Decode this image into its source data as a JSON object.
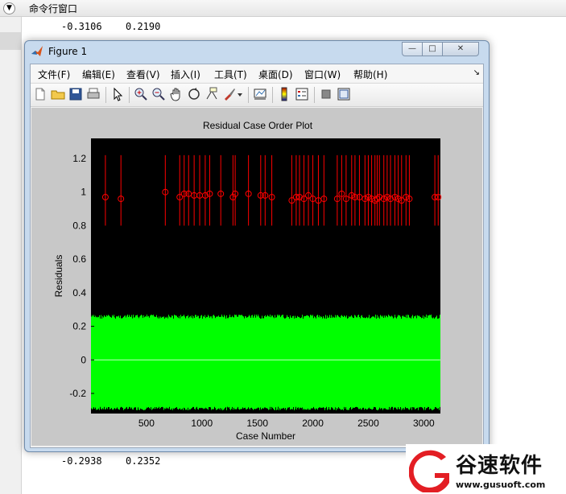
{
  "command_window": {
    "title": "命令行窗口",
    "toggle_glyph": "▼",
    "lines": [
      {
        "a": "-0.3106",
        "b": "0.2190"
      },
      {
        "a": "-0.2938",
        "b": "0.2352"
      }
    ]
  },
  "figure": {
    "title": "Figure 1",
    "window_buttons": {
      "minimize": "—",
      "maximize": "□",
      "close": "✕"
    },
    "menus": [
      "文件(F)",
      "编辑(E)",
      "查看(V)",
      "插入(I)",
      "工具(T)",
      "桌面(D)",
      "窗口(W)",
      "帮助(H)"
    ],
    "menu_overflow": "↘",
    "toolbar_icons": [
      "new-figure-icon",
      "open-file-icon",
      "save-icon",
      "print-icon",
      "pointer-icon",
      "zoom-in-icon",
      "zoom-out-icon",
      "pan-hand-icon",
      "rotate-3d-icon",
      "data-cursor-icon",
      "brush-icon",
      "brush-dropdown-icon",
      "link-plot-icon",
      "colorbar-icon",
      "legend-icon",
      "hide-plot-tools-icon",
      "show-plot-tools-icon"
    ]
  },
  "chart_data": {
    "type": "scatter",
    "title": "Residual Case Order Plot",
    "xlabel": "Case Number",
    "ylabel": "Residuals",
    "xlim": [
      0,
      3150
    ],
    "ylim": [
      -0.32,
      1.32
    ],
    "xticks": [
      500,
      1000,
      1500,
      2000,
      2500,
      3000
    ],
    "yticks": [
      -0.2,
      0,
      0.2,
      0.4,
      0.6,
      0.8,
      1,
      1.2
    ],
    "ytick_labels": [
      "-0.2",
      "0",
      "0.2",
      "0.4",
      "0.6",
      "0.8",
      "1",
      "1.2"
    ],
    "background": "#000000",
    "colors": {
      "normal": "#00ff00",
      "outlier": "#ff0000",
      "zero_line": "#ffffff",
      "figure_bg": "#c8c8c8"
    },
    "normal_residual_band": [
      -0.3,
      0.27
    ],
    "outlier_interval": [
      0.8,
      1.22
    ],
    "outliers_x": [
      130,
      270,
      670,
      800,
      840,
      880,
      930,
      980,
      1030,
      1070,
      1170,
      1280,
      1300,
      1420,
      1530,
      1570,
      1630,
      1810,
      1850,
      1880,
      1920,
      1960,
      2000,
      2050,
      2100,
      2220,
      2260,
      2300,
      2350,
      2380,
      2420,
      2470,
      2500,
      2530,
      2560,
      2580,
      2600,
      2640,
      2670,
      2700,
      2740,
      2770,
      2800,
      2840,
      2870,
      3100,
      3130
    ],
    "outliers_y": [
      0.97,
      0.96,
      1.0,
      0.97,
      0.99,
      0.99,
      0.98,
      0.98,
      0.98,
      0.99,
      0.99,
      0.97,
      0.99,
      0.99,
      0.98,
      0.98,
      0.97,
      0.95,
      0.97,
      0.97,
      0.96,
      0.98,
      0.96,
      0.95,
      0.96,
      0.96,
      0.99,
      0.96,
      0.98,
      0.97,
      0.97,
      0.96,
      0.97,
      0.96,
      0.95,
      0.96,
      0.97,
      0.96,
      0.97,
      0.96,
      0.97,
      0.96,
      0.95,
      0.97,
      0.96,
      0.97,
      0.97
    ]
  },
  "watermark": {
    "text": "谷速软件",
    "url": "www.gusuoft.com"
  }
}
